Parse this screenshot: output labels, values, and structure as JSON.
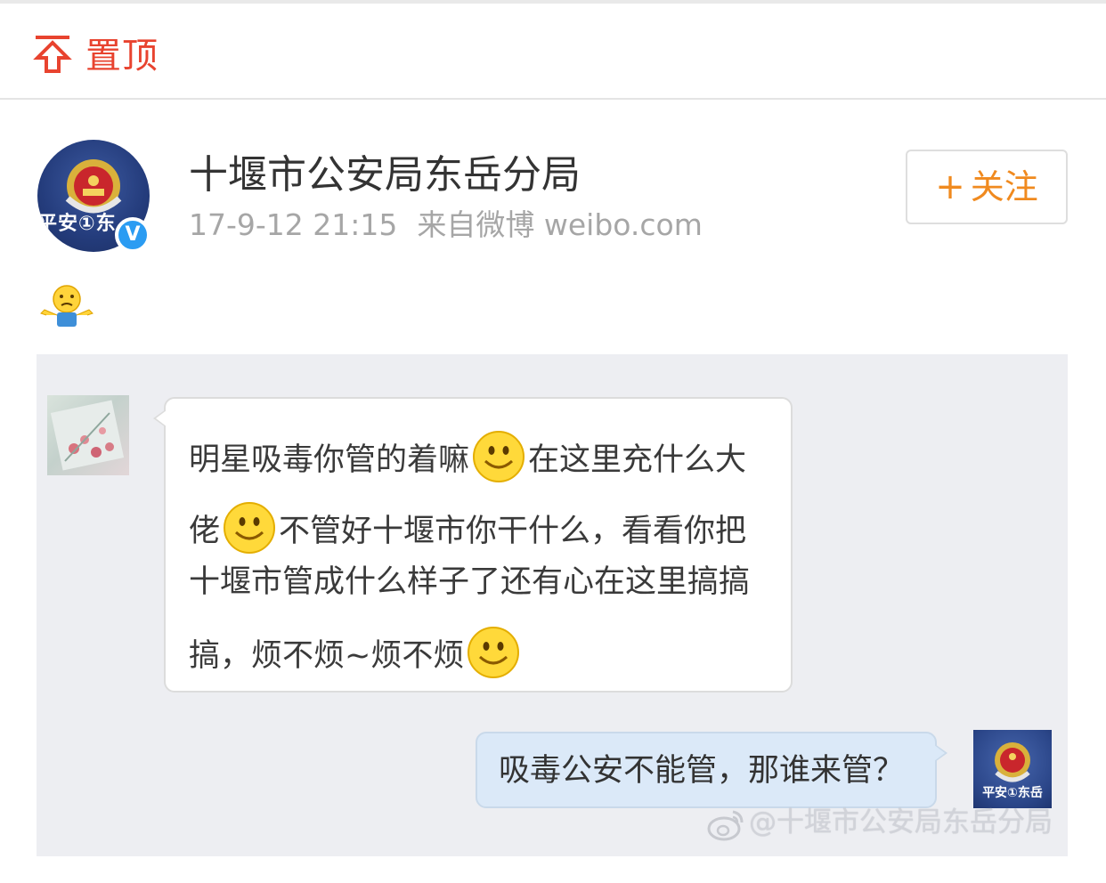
{
  "pin_bar": {
    "label": "置顶"
  },
  "post": {
    "author": "十堰市公安局东岳分局",
    "timestamp": "17-9-12 21:15",
    "source": "来自微博 weibo.com",
    "avatar_text": "平安①东",
    "verified_badge": "V",
    "follow_button": {
      "plus": "+",
      "label": "关注"
    },
    "reaction_icon": "shrug-emoji-icon"
  },
  "screenshot": {
    "incoming_message_lines": [
      {
        "before": "明星吸毒你管的着嘛",
        "after": "在这里充什么大"
      },
      {
        "before": "佬",
        "after": "不管好十堰市你干什么，看看你把"
      },
      {
        "before": "十堰市管成什么样子了还有心在这里搞搞",
        "after": ""
      },
      {
        "before": "搞，烦不烦~烦不烦",
        "after": ""
      }
    ],
    "reply_message": "吸毒公安不能管，那谁来管？",
    "right_avatar_text": "平安①东岳",
    "watermark": "@十堰市公安局东岳分局"
  },
  "colors": {
    "pin_red": "#e8432f",
    "follow_orange": "#f08a1f",
    "verified_blue": "#2b9cf2",
    "reply_bubble": "#dbe9f8"
  }
}
